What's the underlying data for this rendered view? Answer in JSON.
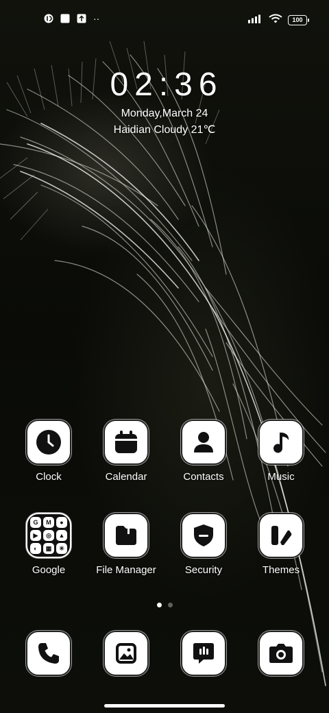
{
  "status_bar": {
    "left_icons": [
      "notification-app-icon",
      "square-notification-icon",
      "upload-icon",
      "more-notifications-icon"
    ],
    "more_indicator": "··",
    "right_icons": [
      "cellular-signal-icon",
      "wifi-icon",
      "battery-icon"
    ],
    "battery": "100"
  },
  "clock_widget": {
    "time": "02:36",
    "date": "Monday,March 24",
    "weather": "Haidian Cloudy 21℃"
  },
  "home_grid": [
    {
      "label": "Clock",
      "icon": "clock-icon"
    },
    {
      "label": "Calendar",
      "icon": "calendar-icon"
    },
    {
      "label": "Contacts",
      "icon": "contacts-icon"
    },
    {
      "label": "Music",
      "icon": "music-note-icon"
    },
    {
      "label": "Google",
      "icon": "google-folder-icon",
      "folder_items": [
        "G",
        "M",
        "●",
        "▶",
        "◎",
        "▲",
        "◐",
        "▦",
        "✳"
      ]
    },
    {
      "label": "File Manager",
      "icon": "folder-icon"
    },
    {
      "label": "Security",
      "icon": "shield-icon"
    },
    {
      "label": "Themes",
      "icon": "themes-icon"
    }
  ],
  "page_indicator": {
    "pages": 2,
    "current": 1
  },
  "dock": [
    {
      "icon": "phone-icon"
    },
    {
      "icon": "gallery-icon"
    },
    {
      "icon": "messages-icon"
    },
    {
      "icon": "camera-icon"
    }
  ],
  "colors": {
    "tile": "#ffffff",
    "glyph": "#111111",
    "background": "#0b0c08"
  }
}
